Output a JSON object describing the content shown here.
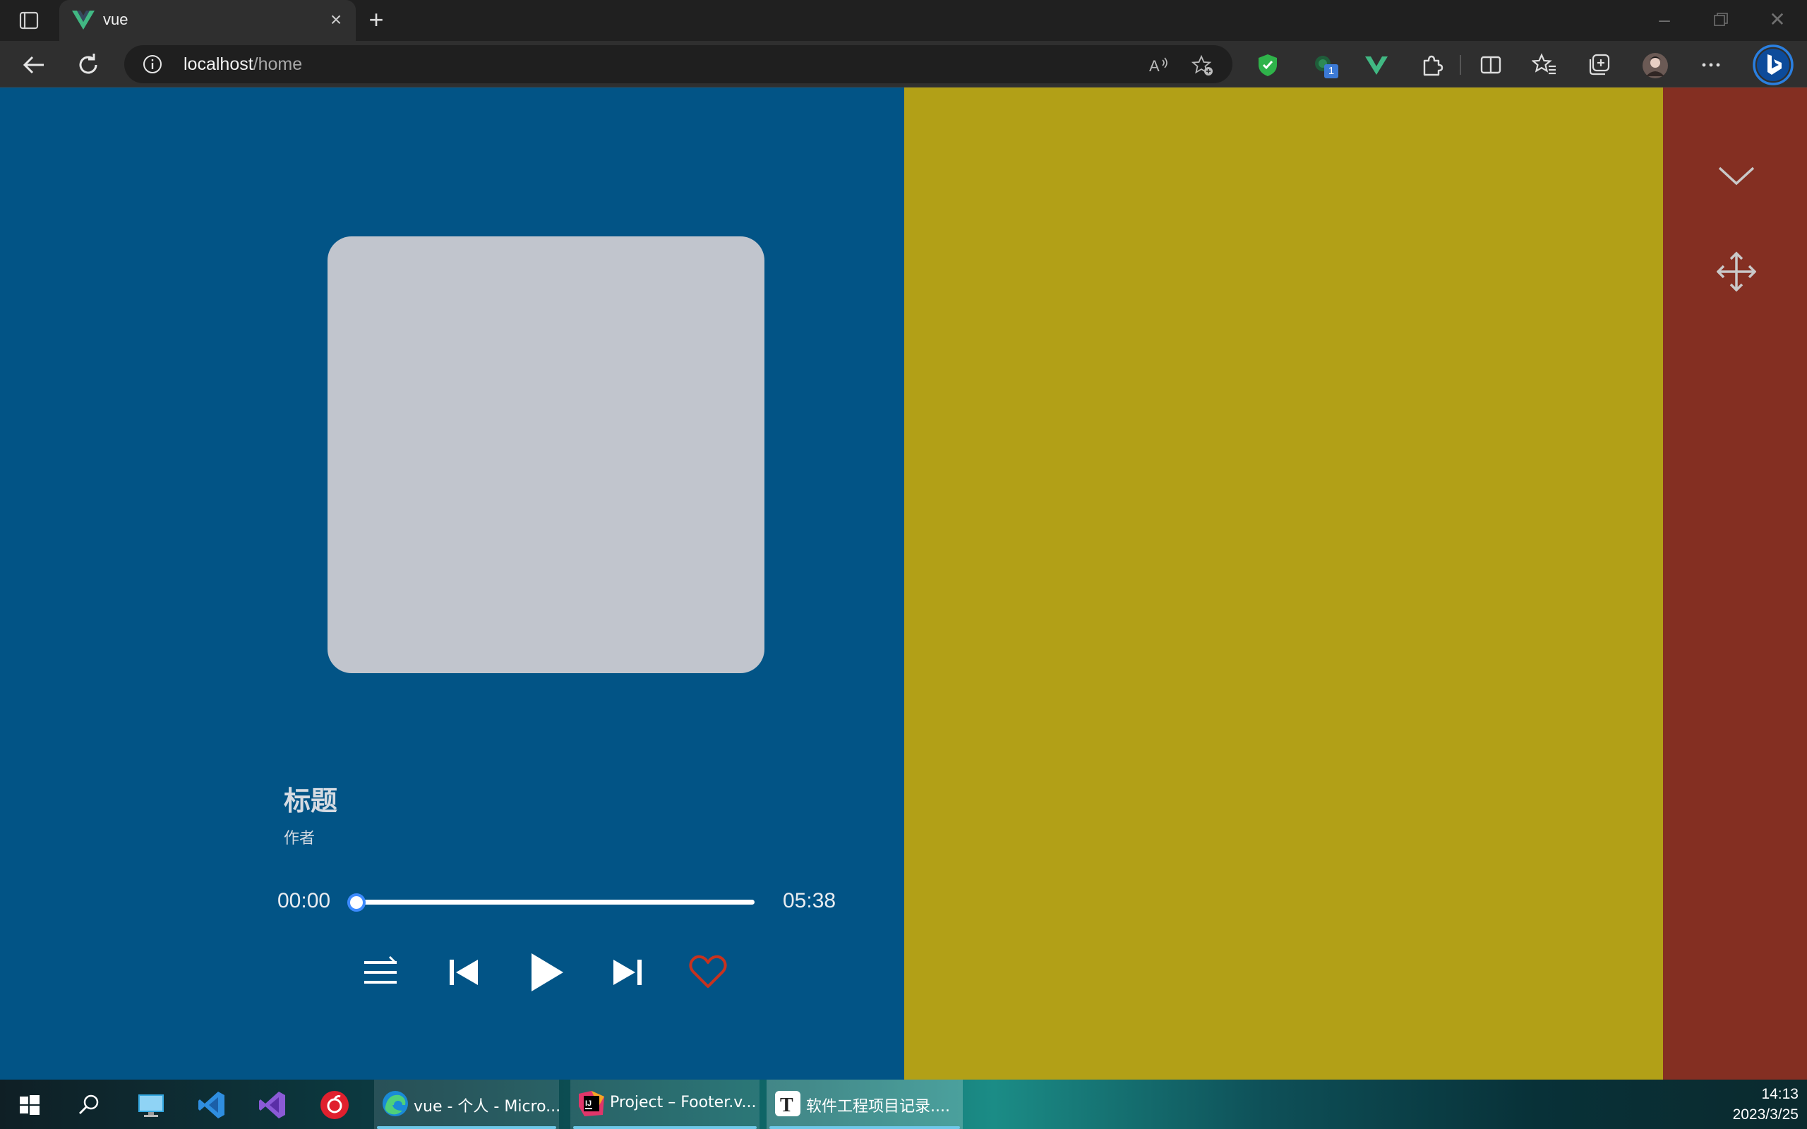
{
  "browser": {
    "tab_title": "vue",
    "address_host": "localhost",
    "address_path": "/home",
    "extension_badge": "1"
  },
  "player": {
    "title": "标题",
    "artist": "作者",
    "current_time": "00:00",
    "total_time": "05:38",
    "progress": 0.0
  },
  "taskbar": {
    "apps": [
      {
        "label": "vue - 个人 - Micro..."
      },
      {
        "label": "Project – Footer.v..."
      },
      {
        "label": "软件工程项目记录...."
      }
    ],
    "clock_time": "14:13",
    "clock_date": "2023/3/25"
  },
  "colors": {
    "left_panel": "#025486",
    "middle_panel": "#b2a017",
    "right_panel": "#842f22",
    "cover": "#c1c5cd",
    "accent": "#3d8bff",
    "favorite": "#c8321e"
  }
}
